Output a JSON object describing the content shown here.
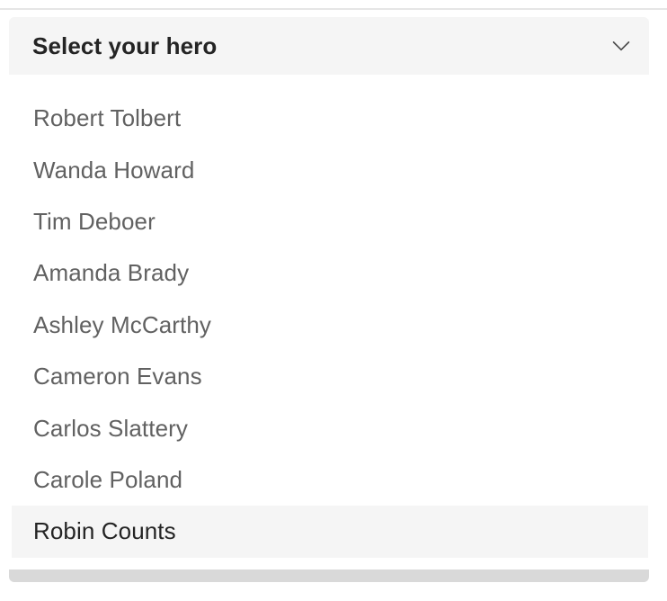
{
  "dropdown": {
    "title": "Select your hero",
    "chevron_icon": "chevron-down-icon",
    "options": [
      "Robert Tolbert",
      "Wanda Howard",
      "Tim Deboer",
      "Amanda Brady",
      "Ashley McCarthy",
      "Cameron Evans",
      "Carlos Slattery",
      "Carole Poland",
      "Robin Counts"
    ],
    "highlighted_option": "Robin Counts"
  },
  "colors": {
    "header_background": "#f5f5f5",
    "title_text": "#242424",
    "option_text": "#616161",
    "highlighted_background": "#f5f5f5",
    "bottom_bar": "#d9d9d9"
  }
}
